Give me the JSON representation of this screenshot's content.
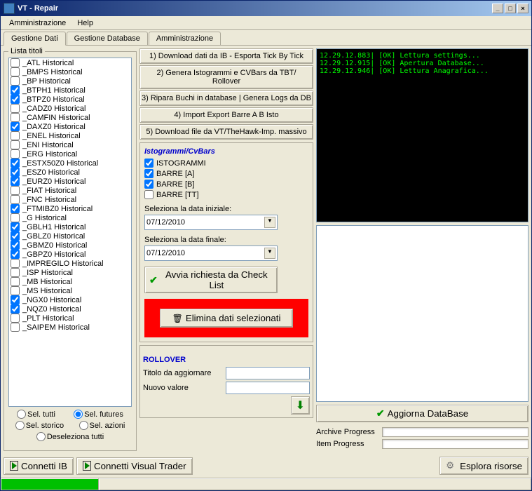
{
  "window": {
    "title": "VT - Repair"
  },
  "menu": {
    "admin": "Amministrazione",
    "help": "Help"
  },
  "tabs": {
    "t1": "Gestione Dati",
    "t2": "Gestione Database",
    "t3": "Amministrazione"
  },
  "listTitle": "Lista titoli",
  "list": [
    {
      "c": false,
      "t": "_ATL   Historical"
    },
    {
      "c": false,
      "t": "_BMPS   Historical"
    },
    {
      "c": false,
      "t": "_BP   Historical"
    },
    {
      "c": true,
      "t": "_BTPH1   Historical"
    },
    {
      "c": true,
      "t": "_BTPZ0   Historical"
    },
    {
      "c": false,
      "t": "_CADZ0   Historical"
    },
    {
      "c": false,
      "t": "_CAMFIN   Historical"
    },
    {
      "c": true,
      "t": "_DAXZ0   Historical"
    },
    {
      "c": false,
      "t": "_ENEL   Historical"
    },
    {
      "c": false,
      "t": "_ENI   Historical"
    },
    {
      "c": false,
      "t": "_ERG   Historical"
    },
    {
      "c": true,
      "t": "_ESTX50Z0   Historical"
    },
    {
      "c": true,
      "t": "_ESZ0   Historical"
    },
    {
      "c": true,
      "t": "_EURZ0   Historical"
    },
    {
      "c": false,
      "t": "_FIAT   Historical"
    },
    {
      "c": false,
      "t": "_FNC   Historical"
    },
    {
      "c": true,
      "t": "_FTMIBZ0   Historical"
    },
    {
      "c": false,
      "t": "_G   Historical"
    },
    {
      "c": true,
      "t": "_GBLH1   Historical"
    },
    {
      "c": true,
      "t": "_GBLZ0   Historical"
    },
    {
      "c": true,
      "t": "_GBMZ0   Historical"
    },
    {
      "c": true,
      "t": "_GBPZ0   Historical"
    },
    {
      "c": false,
      "t": "_IMPREGILO   Historical"
    },
    {
      "c": false,
      "t": "_ISP   Historical"
    },
    {
      "c": false,
      "t": "_MB   Historical"
    },
    {
      "c": false,
      "t": "_MS   Historical"
    },
    {
      "c": true,
      "t": "_NGX0   Historical"
    },
    {
      "c": true,
      "t": "_NQZ0   Historical"
    },
    {
      "c": false,
      "t": "_PLT   Historical"
    },
    {
      "c": false,
      "t": "_SAIPEM   Historical"
    }
  ],
  "radios": {
    "selAll": "Sel. tutti",
    "selFutures": "Sel. futures",
    "selStorico": "Sel. storico",
    "selAzioni": "Sel. azioni",
    "deselAll": "Deseleziona tutti"
  },
  "actions": {
    "a1": "1) Download dati da IB - Esporta Tick By Tick",
    "a2": "2) Genera Istogrammi e CVBars da TBT/ Rollover",
    "a3": "3) Ripara Buchi in database | Genera Logs da DB",
    "a4": "4) Import Export Barre A B Isto",
    "a5": "5) Download file da VT/TheHawk-Imp. massivo"
  },
  "histo": {
    "title": "Istogrammi/CvBars",
    "isto": "ISTOGRAMMI",
    "barreA": "BARRE [A]",
    "barreB": "BARRE [B]",
    "barreTT": "BARRE [TT]",
    "dateStartLabel": "Seleziona la data iniziale:",
    "dateStart": "07/12/2010",
    "dateEndLabel": "Seleziona la data finale:",
    "dateEnd": "07/12/2010",
    "startBtn": "Avvia richiesta da Check List",
    "deleteBtn": "Elimina dati selezionati"
  },
  "rollover": {
    "title": "ROLLOVER",
    "titoloLabel": "Titolo da aggiornare",
    "nuovoLabel": "Nuovo valore"
  },
  "console": {
    "l1": "12.29.12.883| [OK] Lettura settings...",
    "l2": "12.29.12.915| [OK] Apertura Database...",
    "l3": "12.29.12.946| [OK] Lettura Anagrafica..."
  },
  "right": {
    "aggiorna": "Aggiorna DataBase",
    "archive": "Archive Progress",
    "item": "Item Progress"
  },
  "bottom": {
    "connIB": "Connetti IB",
    "connVT": "Connetti Visual Trader",
    "explore": "Esplora risorse"
  }
}
